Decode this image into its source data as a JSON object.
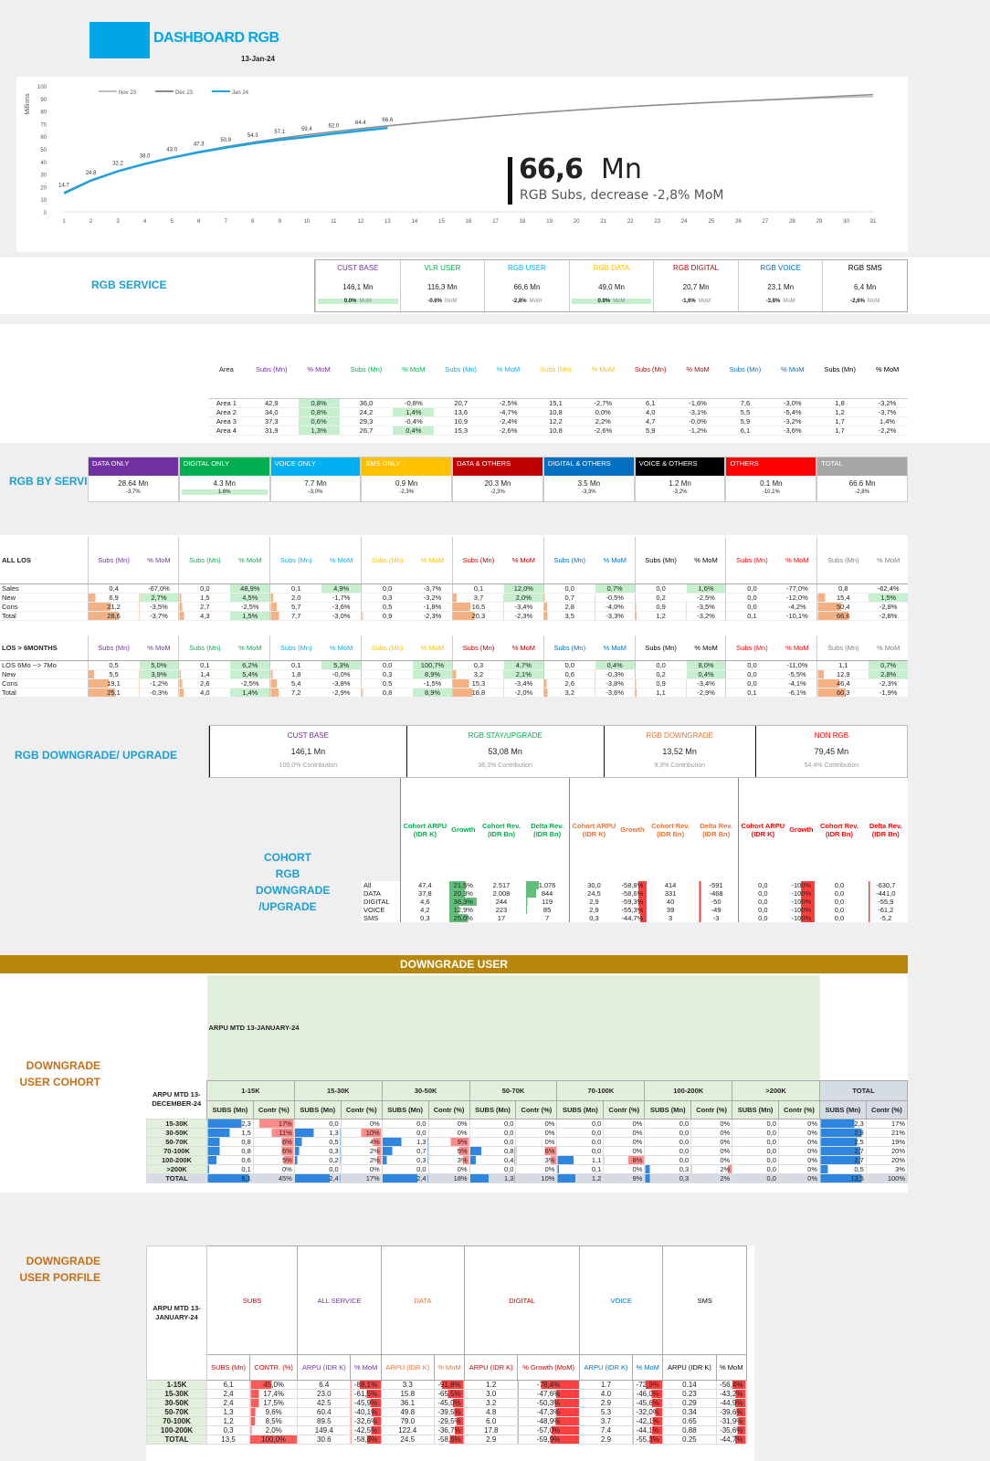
{
  "header": {
    "title": "DASHBOARD RGB",
    "date": "13-Jan-24",
    "brand_color": "#00a6e8"
  },
  "chart_data": {
    "type": "line",
    "ylabel": "Millions",
    "ylim": [
      0,
      100
    ],
    "y_ticks": [
      "0",
      "10",
      "20",
      "30",
      "40",
      "50",
      "60",
      "70",
      "80",
      "90",
      "100"
    ],
    "x": [
      1,
      2,
      3,
      4,
      5,
      6,
      7,
      8,
      9,
      10,
      11,
      12,
      13,
      14,
      15,
      16,
      17,
      18,
      19,
      20,
      21,
      22,
      23,
      24,
      25,
      26,
      27,
      28,
      29,
      30,
      31
    ],
    "series": [
      {
        "name": "Nov 23",
        "color": "#bdbdbd",
        "values": [
          15.5,
          25.3,
          32.6,
          38.5,
          43.3,
          47.8,
          51.7,
          55.3,
          58.4,
          61.2,
          63.7,
          66.1,
          68.3,
          70.4,
          72.4,
          74.3,
          76.1,
          77.8,
          79.4,
          80.9,
          82.3,
          83.6,
          84.8,
          85.9,
          86.9,
          87.8,
          88.7,
          89.5,
          90.2,
          90.9,
          91.5
        ]
      },
      {
        "name": "Dec 23",
        "color": "#8c8c8c",
        "values": [
          15.2,
          25.0,
          32.4,
          38.3,
          43.2,
          47.7,
          51.6,
          55.1,
          58.3,
          61.1,
          63.6,
          66.0,
          68.2,
          70.3,
          72.3,
          74.2,
          76.0,
          77.7,
          79.3,
          80.8,
          82.2,
          83.5,
          84.7,
          85.8,
          86.9,
          87.9,
          88.9,
          89.9,
          90.9,
          92.0,
          93.0
        ]
      },
      {
        "name": "Jan 24",
        "color": "#1ea1de",
        "values": [
          14.7,
          24.8,
          32.2,
          38.0,
          43.0,
          47.3,
          50.9,
          54.3,
          57.1,
          59.4,
          62.0,
          64.4,
          66.6
        ]
      }
    ],
    "data_labels": [
      "14.7",
      "24.8",
      "32.2",
      "38.0",
      "43.0",
      "47.3",
      "50.9",
      "54.3",
      "57.1",
      "59.4",
      "62.0",
      "64.4",
      "66.6"
    ],
    "kpi_value": "66,6",
    "kpi_unit": "Mn",
    "kpi_caption": "RGB Subs, decrease -2,8% MoM"
  },
  "rgb_service": {
    "label": "RGB SERVICE",
    "cards": [
      {
        "title": "CUST BASE",
        "value": "146,1 Mn",
        "mom": "0.0%",
        "color": "#7030a0",
        "good": true
      },
      {
        "title": "VLR USER",
        "value": "116,3 Mn",
        "mom": "-0.6%",
        "color": "#00b050",
        "good": false
      },
      {
        "title": "RGB USER",
        "value": "66,6 Mn",
        "mom": "-2,8%",
        "color": "#00b0f0",
        "good": false
      },
      {
        "title": "RGB DATA",
        "value": "49,0 Mn",
        "mom": "0.9%",
        "color": "#ffc000",
        "good": true
      },
      {
        "title": "RGB DIGITAL",
        "value": "20,7 Mn",
        "mom": "-1,6%",
        "color": "#c00000",
        "good": false
      },
      {
        "title": "RGB VOICE",
        "value": "23,1 Mn",
        "mom": "-3,8%",
        "color": "#0070c0",
        "good": false
      },
      {
        "title": "RGB SMS",
        "value": "6,4 Mn",
        "mom": "-2,6%",
        "color": "#000000",
        "good": false
      }
    ],
    "mom_suffix": "MoM"
  },
  "area": {
    "headers": [
      "Area",
      "Subs (Mn)",
      "% MoM",
      "Subs (Mn)",
      "% MoM",
      "Subs (Mn)",
      "% MoM",
      "Subs (Mn)",
      "% MoM",
      "Subs (Mn)",
      "% MoM",
      "Subs (Mn)",
      "% MoM",
      "Subs (Mn)",
      "% MoM"
    ],
    "rows": [
      [
        "Area 1",
        "42,9",
        "0,8%",
        "36,0",
        "-0,8%",
        "20,7",
        "-2,5%",
        "15,1",
        "-2,7%",
        "6,1",
        "-1,6%",
        "7,6",
        "-3,0%",
        "1,8",
        "-3,2%"
      ],
      [
        "Area 2",
        "34,0",
        "0,8%",
        "24,2",
        "1,4%",
        "13,6",
        "-4,7%",
        "10,8",
        "0,0%",
        "4,0",
        "-3,1%",
        "5,5",
        "-5,4%",
        "1,2",
        "-3,7%"
      ],
      [
        "Area 3",
        "37,3",
        "0,6%",
        "29,3",
        "-0,4%",
        "10,9",
        "-2,4%",
        "12,2",
        "2,2%",
        "4,7",
        "-0,0%",
        "5,9",
        "-3,2%",
        "1,7",
        "1,4%"
      ],
      [
        "Area 4",
        "31,9",
        "1,3%",
        "26,7",
        "0,4%",
        "15,3",
        "-2,6%",
        "10,8",
        "-2,6%",
        "5,9",
        "-1,2%",
        "6,1",
        "-3,6%",
        "1,7",
        "-2,2%"
      ]
    ]
  },
  "rgb_by_service": {
    "label": "RGB BY SERVICE",
    "cards": [
      {
        "title": "DATA ONLY",
        "value": "28.64  Mn",
        "mom": "-3,7%",
        "color": "#7030a0"
      },
      {
        "title": "DIGITAL ONLY",
        "value": "4.3 Mn",
        "mom": "1.6%",
        "color": "#00b050"
      },
      {
        "title": "VOICE ONLY",
        "value": "7.7 Mn",
        "mom": "-3,0%",
        "color": "#00b0f0"
      },
      {
        "title": "SMS ONLY",
        "value": "0.9 Mn",
        "mom": "-2,3%",
        "color": "#ffc000"
      },
      {
        "title": "DATA & OTHERS",
        "value": "20.3 Mn",
        "mom": "-2,3%",
        "color": "#c00000"
      },
      {
        "title": "DIGITAL & OTHERS",
        "value": "3.5 Mn",
        "mom": "-3,3%",
        "color": "#0070c0"
      },
      {
        "title": "VOICE & OTHERS",
        "value": "1.2 Mn",
        "mom": "-3,2%",
        "color": "#000000"
      },
      {
        "title": "OTHERS",
        "value": "0.1 Mn",
        "mom": "-10,1%",
        "color": "#ff0000"
      },
      {
        "title": "TOTAL",
        "value": "66.6 Mn",
        "mom": "-2,8%",
        "color": "#a6a6a6"
      }
    ]
  },
  "los_all": {
    "title": "ALL LOS",
    "sub": "Subs (Mn)",
    "mom": "% MoM",
    "rows": [
      [
        "Sales",
        "0,4",
        "-67,0%",
        "0,0",
        "48,9%",
        "0,1",
        "4,9%",
        "0,0",
        "-3,7%",
        "0,1",
        "12,0%",
        "0,0",
        "0,7%",
        "0,0",
        "1,6%",
        "0,0",
        "-77,0%",
        "0,8",
        "-62,4%"
      ],
      [
        "New",
        "6,9",
        "2,7%",
        "1,5",
        "4,5%",
        "2,0",
        "-1,7%",
        "0,3",
        "-3,2%",
        "3,7",
        "2,0%",
        "0,7",
        "-0,5%",
        "0,2",
        "-2,5%",
        "0,0",
        "-12,0%",
        "15,4",
        "1,5%"
      ],
      [
        "Cons",
        "21,2",
        "-3,5%",
        "2,7",
        "-2,5%",
        "5,7",
        "-3,6%",
        "0,5",
        "-1,8%",
        "16,5",
        "-3,4%",
        "2,8",
        "-4,0%",
        "0,9",
        "-3,5%",
        "0,0",
        "-4,2%",
        "50,4",
        "-2,8%"
      ],
      [
        "Total",
        "28,6",
        "-3,7%",
        "4,3",
        "1,5%",
        "7,7",
        "-3,0%",
        "0,9",
        "-2,3%",
        "20,3",
        "-2,3%",
        "3,5",
        "-3,3%",
        "1,2",
        "-3,2%",
        "0,1",
        "-10,1%",
        "66,6",
        "-2,8%"
      ]
    ]
  },
  "los_6m": {
    "title": "LOS > 6MONTHS",
    "rows": [
      [
        "LOS 6Mo --> 7Mo",
        "0,5",
        "5,0%",
        "0,1",
        "6,2%",
        "0,1",
        "5,3%",
        "0,0",
        "100,7%",
        "0,3",
        "4,7%",
        "0,0",
        "0,4%",
        "0,0",
        "8,0%",
        "0,0",
        "-11,0%",
        "1,1",
        "0,7%"
      ],
      [
        "New",
        "5,5",
        "3,9%",
        "1,4",
        "5,4%",
        "1,8",
        "-0,0%",
        "0,3",
        "8,9%",
        "3,2",
        "2,1%",
        "0,6",
        "-0,3%",
        "0,2",
        "0,4%",
        "0,0",
        "-5,5%",
        "12,9",
        "2,8%"
      ],
      [
        "Cons",
        "19,1",
        "-1,2%",
        "2,6",
        "-2,5%",
        "5,4",
        "-3,8%",
        "0,5",
        "-1,5%",
        "15,3",
        "-3,4%",
        "2,6",
        "-3,8%",
        "0,9",
        "-3,4%",
        "0,0",
        "-4,1%",
        "46,4",
        "-2,3%"
      ],
      [
        "Total",
        "25,1",
        "-0,3%",
        "4,0",
        "1,4%",
        "7,2",
        "-2,9%",
        "0,8",
        "8,9%",
        "18,8",
        "-2,0%",
        "3,2",
        "-3,6%",
        "1,1",
        "-2,9%",
        "0,1",
        "-6,1%",
        "60,3",
        "-1,9%"
      ]
    ]
  },
  "los_colors": [
    "#7030a0",
    "#00b050",
    "#00b0f0",
    "#ffc000",
    "#c00000",
    "#0070c0",
    "#000000",
    "#ff0000",
    "#808080"
  ],
  "downgrade": {
    "label": "RGB DOWNGRADE/  UPGRADE",
    "cards": [
      {
        "title": "CUST BASE",
        "value": "146,1  Mn",
        "contrib": "100,0% Contribution",
        "color": "#7030a0"
      },
      {
        "title": "RGB STAY/UPGRADE",
        "value": "53,08  Mn",
        "contrib": "36,3% Contribution",
        "color": "#00b050"
      },
      {
        "title": "RGB DOWNGRADE",
        "value": "13,52  Mn",
        "contrib": "9,3% Contribution",
        "color": "#e97132"
      },
      {
        "title": "NON RGB",
        "value": "79,45  Mn",
        "contrib": "54,4% Contribution",
        "color": "#ff0000"
      }
    ]
  },
  "cohort": {
    "label": "COHORT  RGB DOWNGRADE /UPGRADE",
    "headers": [
      "Cohort ARPU (IDR K)",
      "Growth",
      "Cohort Rev. (IDR Bn)",
      "Delta Rev. (IDR Bn)"
    ],
    "rows": [
      [
        "All",
        "47,4",
        "21,5%",
        "2.517",
        "1.076",
        "30,0",
        "-58,8%",
        "414",
        "-591",
        "0,0",
        "-100%",
        "0,0",
        "-630,7"
      ],
      [
        "DATA",
        "37,8",
        "20,3%",
        "2.008",
        "844",
        "24,5",
        "-58,6%",
        "331",
        "-468",
        "0,0",
        "-100%",
        "0,0",
        "-441,0"
      ],
      [
        "DIGITAL",
        "4,6",
        "36,3%",
        "244",
        "119",
        "2,9",
        "-59,3%",
        "40",
        "-50",
        "0,0",
        "-100%",
        "0,0",
        "-55,9"
      ],
      [
        "VOICE",
        "4,2",
        "12,9%",
        "223",
        "85",
        "2,9",
        "-55,3%",
        "39",
        "-49",
        "0,0",
        "-100%",
        "0,0",
        "-61,2"
      ],
      [
        "SMS",
        "0,3",
        "25,0%",
        "17",
        "7",
        "0,3",
        "-44,7%",
        "3",
        "-3",
        "0,0",
        "-100%",
        "0,0",
        "-5,2"
      ]
    ]
  },
  "downgrade_user": {
    "banner": "DOWNGRADE USER",
    "label": "DOWNGRADE USER COHORT",
    "arpu_title": "ARPU MTD 13-JANUARY-24",
    "row_title": "ARPU MTD 13-DECEMBER-24",
    "groups": [
      "1-15K",
      "15-30K",
      "30-50K",
      "50-70K",
      "70-100K",
      "100-200K",
      ">200K",
      "TOTAL"
    ],
    "subs": "SUBS (Mn)",
    "contr": "Contr (%)",
    "rows": [
      [
        "15-30K",
        "2,3",
        "17%",
        "0,0",
        "0%",
        "0,0",
        "0%",
        "0,0",
        "0%",
        "0,0",
        "0%",
        "0,0",
        "0%",
        "0,0",
        "0%",
        "2,3",
        "17%"
      ],
      [
        "30-50K",
        "1,5",
        "11%",
        "1,3",
        "10%",
        "0,0",
        "0%",
        "0,0",
        "0%",
        "0,0",
        "0%",
        "0,0",
        "0%",
        "0,0",
        "0%",
        "2,8",
        "21%"
      ],
      [
        "50-70K",
        "0,8",
        "6%",
        "0,5",
        "4%",
        "1,3",
        "9%",
        "0,0",
        "0%",
        "0,0",
        "0%",
        "0,0",
        "0%",
        "0,0",
        "0%",
        "2,5",
        "19%"
      ],
      [
        "70-100K",
        "0,8",
        "6%",
        "0,3",
        "2%",
        "0,7",
        "5%",
        "0,8",
        "6%",
        "0,0",
        "0%",
        "0,0",
        "0%",
        "0,0",
        "0%",
        "2,7",
        "20%"
      ],
      [
        "100-200K",
        "0,6",
        "5%",
        "0,2",
        "2%",
        "0,3",
        "3%",
        "0,4",
        "3%",
        "1,1",
        "8%",
        "0,0",
        "0%",
        "0,0",
        "0%",
        "2,7",
        "20%"
      ],
      [
        ">200K",
        "0,1",
        "0%",
        "0,0",
        "0%",
        "0,0",
        "0%",
        "0,0",
        "0%",
        "0,1",
        "0%",
        "0,3",
        "2%",
        "0,0",
        "0%",
        "0,5",
        "3%"
      ],
      [
        "TOTAL",
        "6,1",
        "45%",
        "2,4",
        "17%",
        "2,4",
        "18%",
        "1,3",
        "10%",
        "1,2",
        "9%",
        "0,3",
        "2%",
        "0,0",
        "0%",
        "13,5",
        "100%"
      ]
    ]
  },
  "profile": {
    "label": "DOWNGRADE USER PORFILE",
    "row_title": "ARPU MTD 13-JANUARY-24",
    "groups": [
      {
        "t": "SUBS",
        "c": "#c00000"
      },
      {
        "t": "ALL SERVICE",
        "c": "#7030a0"
      },
      {
        "t": "DATA",
        "c": "#e97132"
      },
      {
        "t": "DIGITAL",
        "c": "#c00000"
      },
      {
        "t": "VOICE",
        "c": "#0070c0"
      },
      {
        "t": "SMS",
        "c": "#000000"
      }
    ],
    "sub": [
      "SUBS (Mn)",
      "CONTR. (%)",
      "ARPU (IDR K)",
      "% MoM",
      "ARPU (IDR K)",
      "% MoM",
      "ARPU (IDR K)",
      "% Growth (MoM)",
      "ARPU (IDR K)",
      "% MoM",
      "ARPU (IDR K)",
      "% MoM"
    ],
    "rows": [
      [
        "1-15K",
        "6,1",
        "45,0%",
        "6.4",
        "-88,1%",
        "3.3",
        "-91,8%",
        "1.2",
        "-78,4%",
        "1.7",
        "-72,9%",
        "0.14",
        "-56,4%"
      ],
      [
        "15-30K",
        "2,4",
        "17,4%",
        "23.0",
        "-61,5%",
        "15.8",
        "-65,5%",
        "3.0",
        "-47,6%",
        "4.0",
        "-46,0%",
        "0.23",
        "-43,2%"
      ],
      [
        "30-50K",
        "2,4",
        "17,5%",
        "42.5",
        "-45,9%",
        "36.1",
        "-45,0%",
        "3.2",
        "-50,3%",
        "2.9",
        "-45,6%",
        "0.29",
        "-44,9%"
      ],
      [
        "50-70K",
        "1,3",
        "9,6%",
        "60.4",
        "-40,1%",
        "49.8",
        "-39,5%",
        "4.8",
        "-47,3%",
        "5.3",
        "-32,0%",
        "0.34",
        "-39,6%"
      ],
      [
        "70-100K",
        "1,2",
        "8,5%",
        "89.5",
        "-32,6%",
        "79.0",
        "-29,5%",
        "6.0",
        "-48,9%",
        "3.7",
        "-42,1%",
        "0.65",
        "-31,9%"
      ],
      [
        "100-200K",
        "0,3",
        "2,0%",
        "149.4",
        "-42,5%",
        "122.4",
        "-36,7%",
        "17.8",
        "-57,0%",
        "7.4",
        "-44,1%",
        "0.88",
        "-35,6%"
      ],
      [
        "TOTAL",
        "13,5",
        "100,0%",
        "30.6",
        "-58,8%",
        "24.5",
        "-58,6%",
        "2.9",
        "-59,9%",
        "2.9",
        "-55,3%",
        "0.25",
        "-44,7%"
      ]
    ]
  }
}
